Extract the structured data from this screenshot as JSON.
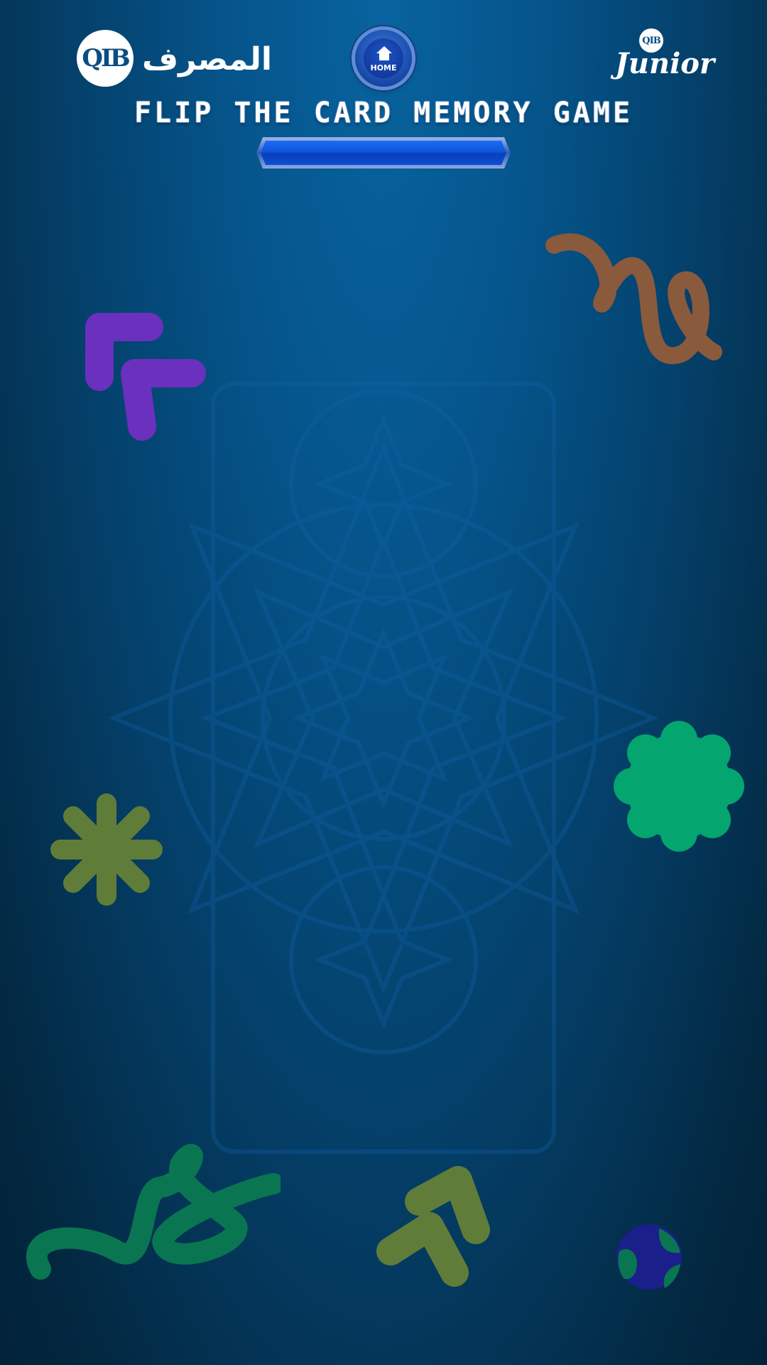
{
  "header": {
    "bank_logo_text": "QIB",
    "bank_arabic_name": "المصرف",
    "home_button_label": "HOME",
    "home_icon": "home-icon",
    "junior_badge_text": "QIB",
    "junior_logo_text": "Junior"
  },
  "game": {
    "title": "FLIP THE CARD MEMORY GAME",
    "progress_fraction": 0
  },
  "colors": {
    "background_top": "#08639e",
    "background_bottom": "#02223a",
    "purple_shape": "#6b30bd",
    "brown_shape": "#8a5a3c",
    "green_shape": "#04a56f",
    "olive_shape": "#5f7d39",
    "dark_green_shape": "#0a7551",
    "navy_shape": "#1a1f8a",
    "progress_bar": "#0b4fd6"
  }
}
